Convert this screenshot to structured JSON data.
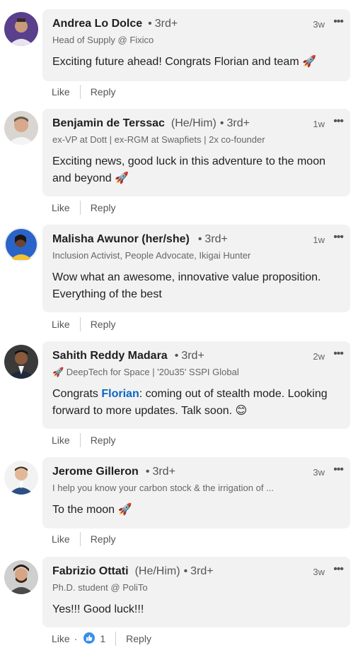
{
  "comments": [
    {
      "name": "Andrea Lo Dolce",
      "pronouns": "",
      "degree": "3rd+",
      "headline": "Head of Supply @ Fixico",
      "time": "3w",
      "text": "Exciting future ahead! Congrats Florian and team 🚀",
      "actions": {
        "like": "Like",
        "reply": "Reply"
      }
    },
    {
      "name": "Benjamin de Terssac",
      "pronouns": "(He/Him)",
      "degree": "3rd+",
      "headline": "ex-VP at Dott | ex-RGM at Swapfiets | 2x co-founder",
      "time": "1w",
      "text": "Exciting news, good luck in this adventure to the moon and beyond 🚀",
      "actions": {
        "like": "Like",
        "reply": "Reply"
      }
    },
    {
      "name": "Malisha Awunor (her/she)",
      "pronouns": "",
      "degree": "3rd+",
      "headline": "Inclusion Activist, People Advocate, Ikigai Hunter",
      "time": "1w",
      "text": "Wow what an awesome, innovative value proposition. Everything of the best",
      "actions": {
        "like": "Like",
        "reply": "Reply"
      }
    },
    {
      "name": "Sahith Reddy Madara",
      "pronouns": "",
      "degree": "3rd+",
      "headline": "🚀 DeepTech for Space | '20u35' SSPI Global",
      "time": "2w",
      "text_before": "Congrats ",
      "mention": "Florian",
      "text_after": ": coming out of stealth mode. Looking forward to more updates. Talk soon. 😊",
      "actions": {
        "like": "Like",
        "reply": "Reply"
      }
    },
    {
      "name": "Jerome Gilleron",
      "pronouns": "",
      "degree": "3rd+",
      "headline": "I help you know your carbon stock & the irrigation of ...",
      "time": "3w",
      "text": "To the moon 🚀",
      "actions": {
        "like": "Like",
        "reply": "Reply"
      }
    },
    {
      "name": "Fabrizio Ottati",
      "pronouns": "(He/Him)",
      "degree": "3rd+",
      "headline": "Ph.D. student @ PoliTo",
      "time": "3w",
      "text": "Yes!!! Good luck!!!",
      "actions": {
        "like": "Like",
        "reply": "Reply",
        "reaction_count": "1",
        "reaction_icon": "thumbs-up-icon"
      }
    }
  ],
  "colors": {
    "bubble": "#f2f2f2",
    "mention": "#0a66c2",
    "like_badge": "#378fe9"
  }
}
